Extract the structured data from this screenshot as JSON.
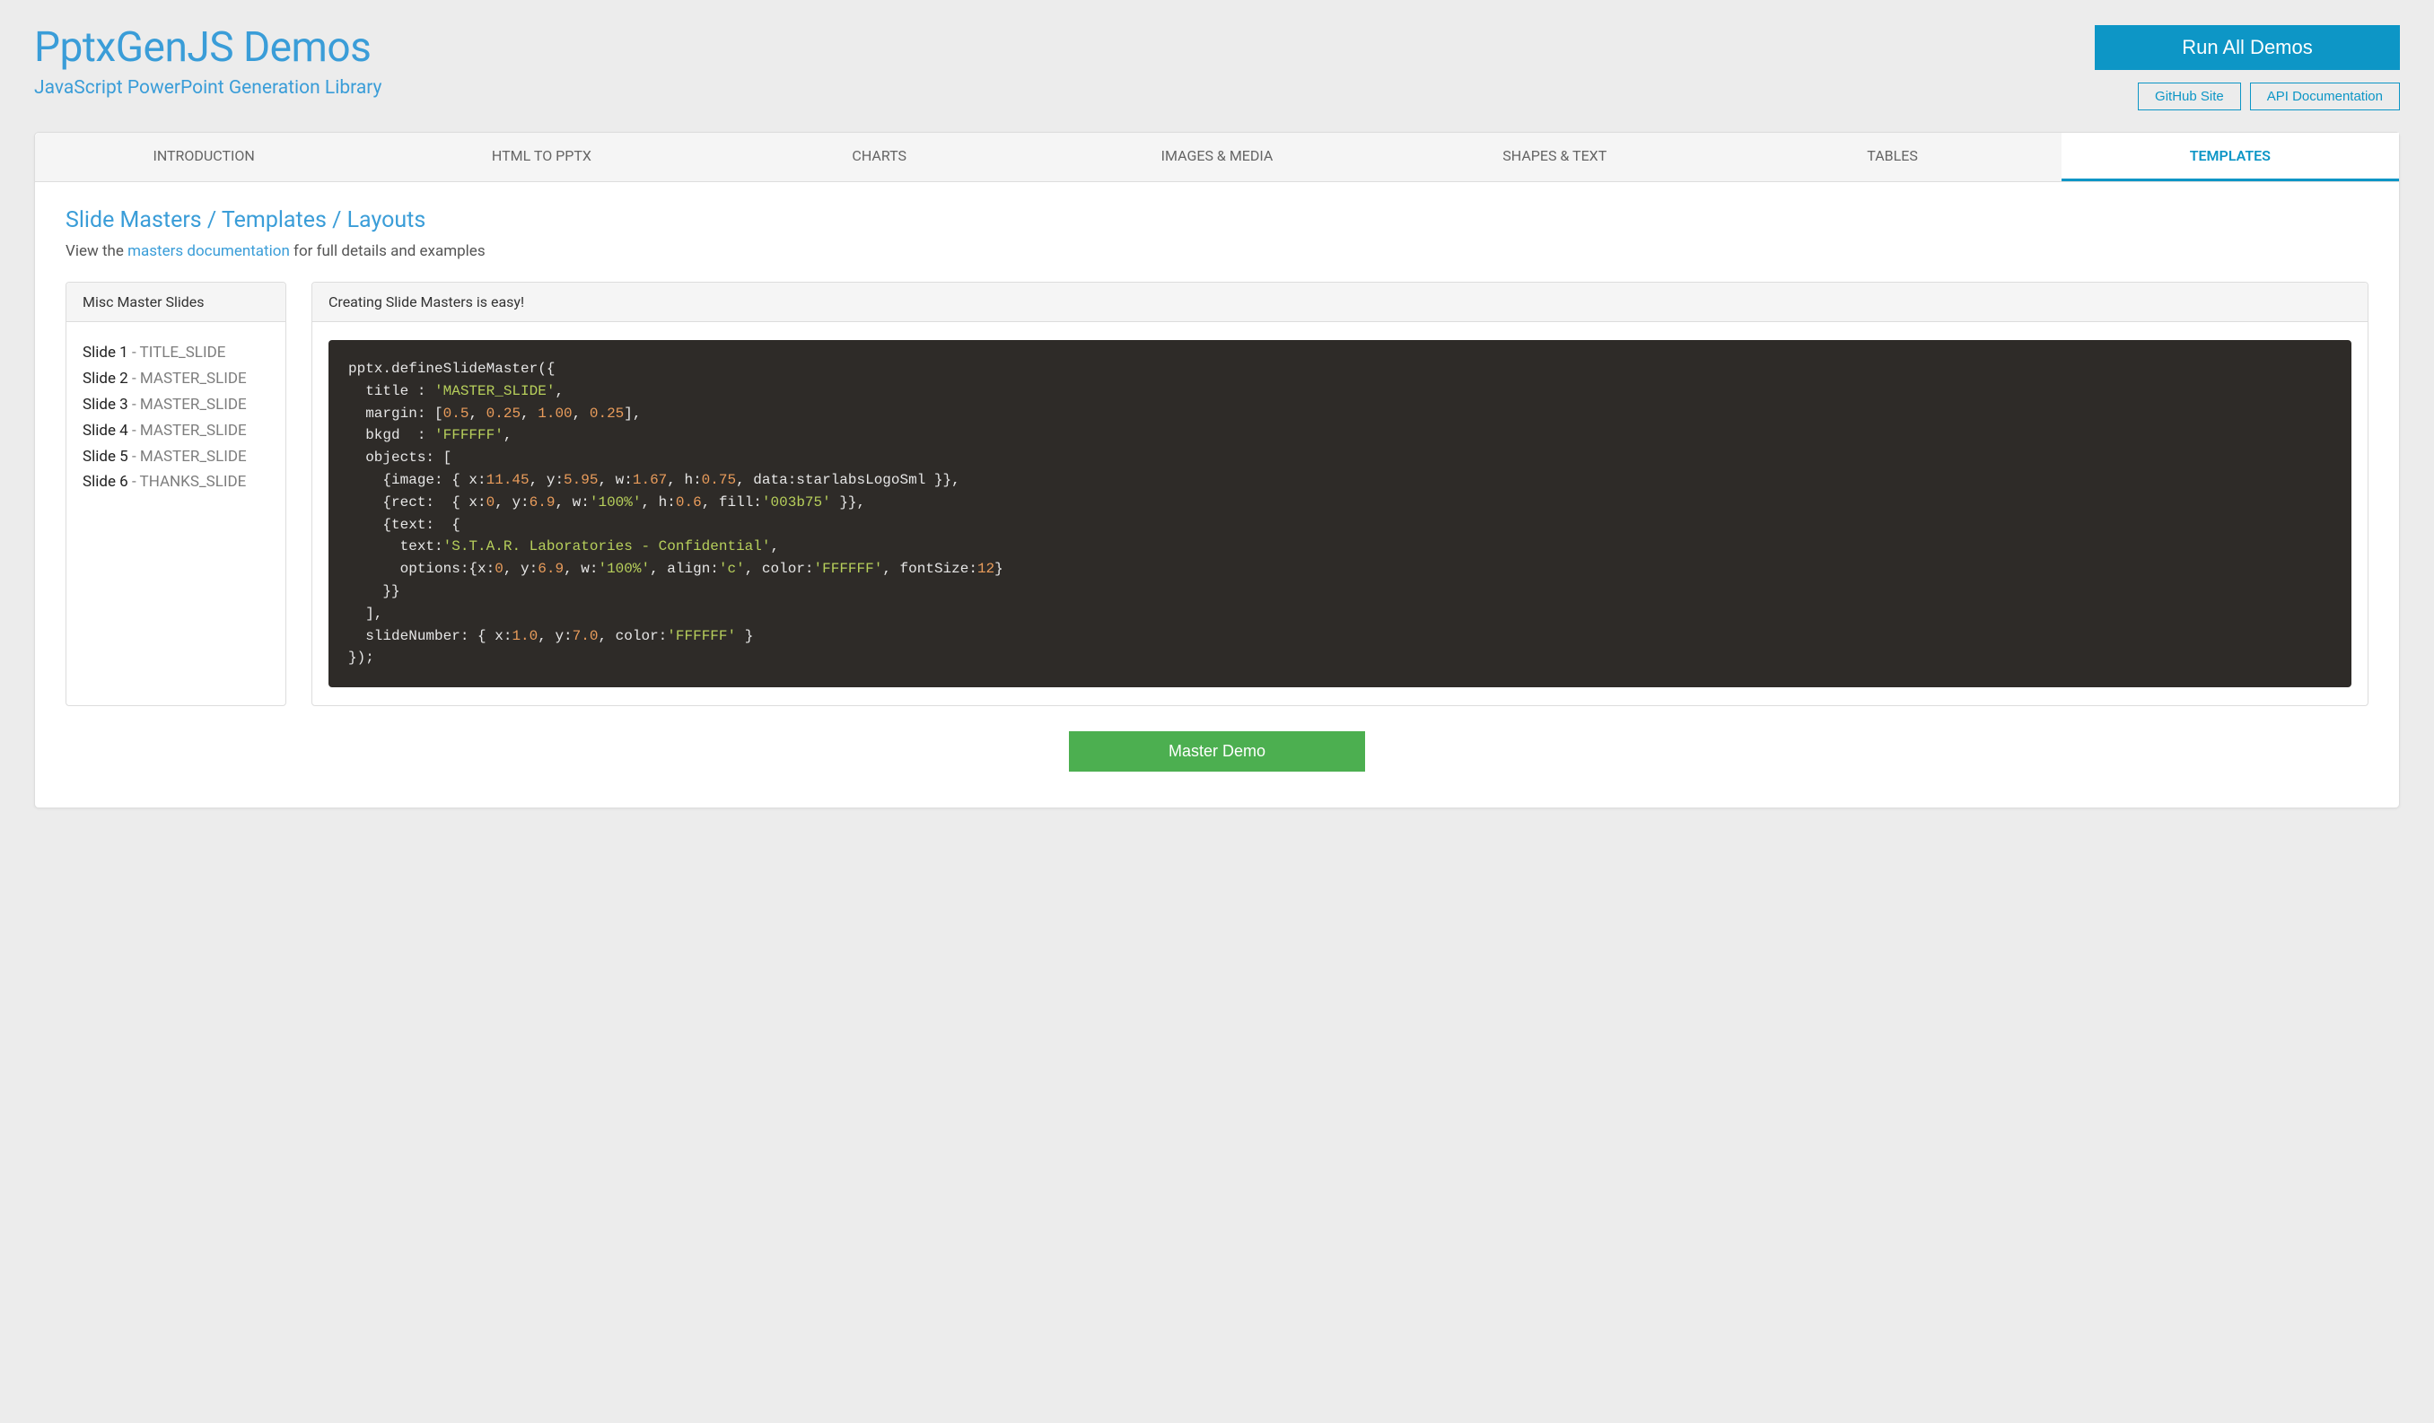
{
  "header": {
    "title": "PptxGenJS Demos",
    "subtitle": "JavaScript PowerPoint Generation Library",
    "run_button": "Run All Demos",
    "github_button": "GitHub Site",
    "apidoc_button": "API Documentation"
  },
  "tabs": [
    {
      "id": "intro",
      "label": "INTRODUCTION",
      "active": false
    },
    {
      "id": "html",
      "label": "HTML TO PPTX",
      "active": false
    },
    {
      "id": "charts",
      "label": "CHARTS",
      "active": false
    },
    {
      "id": "images",
      "label": "IMAGES & MEDIA",
      "active": false
    },
    {
      "id": "shapes",
      "label": "SHAPES & TEXT",
      "active": false
    },
    {
      "id": "tables",
      "label": "TABLES",
      "active": false
    },
    {
      "id": "templates",
      "label": "TEMPLATES",
      "active": true
    }
  ],
  "section": {
    "title": "Slide Masters / Templates / Layouts",
    "desc_prefix": "View the ",
    "desc_link": "masters documentation",
    "desc_suffix": " for full details and examples"
  },
  "left_panel": {
    "heading": "Misc Master Slides",
    "slides": [
      {
        "name": "Slide 1",
        "master": "TITLE_SLIDE"
      },
      {
        "name": "Slide 2",
        "master": "MASTER_SLIDE"
      },
      {
        "name": "Slide 3",
        "master": "MASTER_SLIDE"
      },
      {
        "name": "Slide 4",
        "master": "MASTER_SLIDE"
      },
      {
        "name": "Slide 5",
        "master": "MASTER_SLIDE"
      },
      {
        "name": "Slide 6",
        "master": "THANKS_SLIDE"
      }
    ]
  },
  "right_panel": {
    "heading": "Creating Slide Masters is easy!",
    "demo_button": "Master Demo"
  },
  "code": {
    "l1_a": "pptx.defineSlideMaster({",
    "l2_a": "  title : ",
    "l2_b": "'MASTER_SLIDE'",
    "l2_c": ",",
    "l3_a": "  margin: [",
    "l3_n1": "0.5",
    "l3_s1": ", ",
    "l3_n2": "0.25",
    "l3_s2": ", ",
    "l3_n3": "1.00",
    "l3_s3": ", ",
    "l3_n4": "0.25",
    "l3_b": "],",
    "l4_a": "  bkgd  : ",
    "l4_b": "'FFFFFF'",
    "l4_c": ",",
    "l5_a": "  objects: [",
    "l6_a": "    {image: { x:",
    "l6_n1": "11.45",
    "l6_s1": ", y:",
    "l6_n2": "5.95",
    "l6_s2": ", w:",
    "l6_n3": "1.67",
    "l6_s3": ", h:",
    "l6_n4": "0.75",
    "l6_s4": ", data:starlabsLogoSml }},",
    "l7_a": "    {rect:  { x:",
    "l7_n1": "0",
    "l7_s1": ", y:",
    "l7_n2": "6.9",
    "l7_s2": ", w:",
    "l7_str1": "'100%'",
    "l7_s3": ", h:",
    "l7_n3": "0.6",
    "l7_s4": ", fill:",
    "l7_str2": "'003b75'",
    "l7_s5": " }},",
    "l8_a": "    {text:  {",
    "l9_a": "      text:",
    "l9_b": "'S.T.A.R. Laboratories - Confidential'",
    "l9_c": ",",
    "l10_a": "      options:{x:",
    "l10_n1": "0",
    "l10_s1": ", y:",
    "l10_n2": "6.9",
    "l10_s2": ", w:",
    "l10_str1": "'100%'",
    "l10_s3": ", align:",
    "l10_str2": "'c'",
    "l10_s4": ", color:",
    "l10_str3": "'FFFFFF'",
    "l10_s5": ", fontSize:",
    "l10_n3": "12",
    "l10_s6": "}",
    "l11_a": "    }}",
    "l12_a": "  ],",
    "l13_a": "  slideNumber: { x:",
    "l13_n1": "1.0",
    "l13_s1": ", y:",
    "l13_n2": "7.0",
    "l13_s2": ", color:",
    "l13_str1": "'FFFFFF'",
    "l13_s3": " }",
    "l14_a": "});"
  }
}
